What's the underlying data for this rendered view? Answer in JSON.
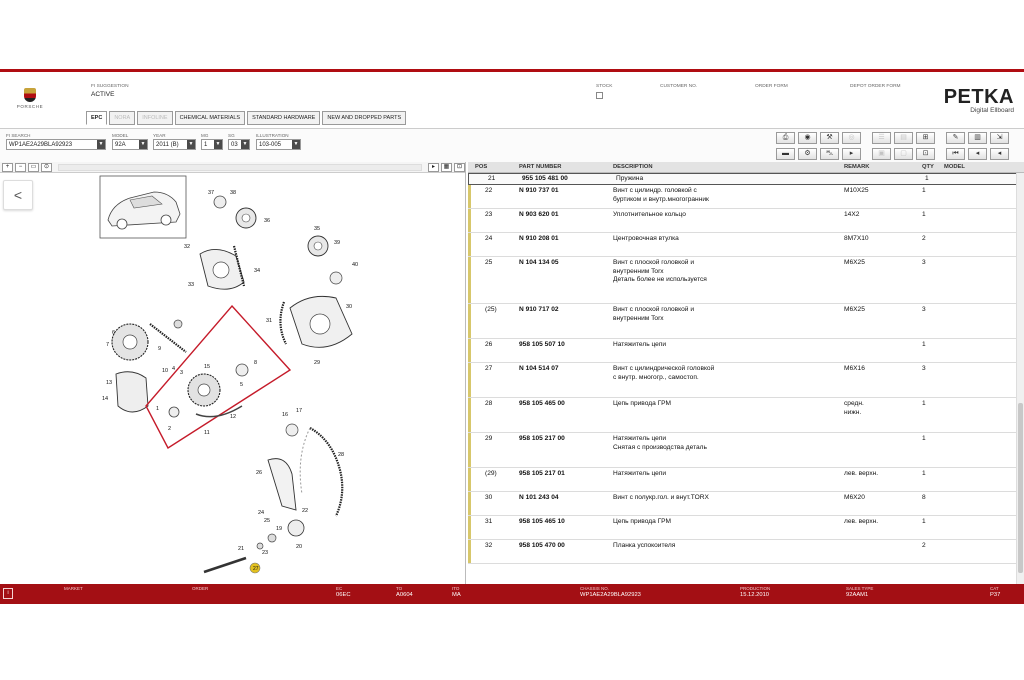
{
  "header": {
    "logo_text": "PORSCHE",
    "fi_suggestion_label": "FI SUGGESTION",
    "fi_suggestion_value": "ACTIVE",
    "stock_label": "STOCK",
    "customer_no_label": "CUSTOMER NO.",
    "order_form_label": "ORDER FORM",
    "depot_order_form_label": "DEPOT ORDER FORM",
    "petka_title": "PETKA",
    "petka_subtitle": "Digital Ellboard"
  },
  "tabs": [
    {
      "label": "EPC"
    },
    {
      "label": "NORA"
    },
    {
      "label": "INFOLINE"
    },
    {
      "label": "CHEMICAL MATERIALS"
    },
    {
      "label": "STANDARD HARDWARE"
    },
    {
      "label": "NEW AND DROPPED PARTS"
    }
  ],
  "filters": {
    "fi_search_label": "FI SEARCH",
    "fi_search_value": "WP1AE2A29BLA92923",
    "model_label": "MODEL",
    "model_value": "92A",
    "year_label": "YEAR",
    "year_value": "2011 (B)",
    "mg_label": "MG",
    "mg_value": "1",
    "sg_label": "SG",
    "sg_value": "03",
    "illustration_label": "ILLUSTRATION",
    "illustration_value": "103-005"
  },
  "table": {
    "headers": {
      "pos": "POS",
      "part_number": "PART NUMBER",
      "description": "DESCRIPTION",
      "remark": "REMARK",
      "qty": "QTY",
      "model": "MODEL"
    },
    "rows": [
      {
        "pos": "21",
        "part": "955 105 481 00",
        "desc": "Пружина",
        "remark": "",
        "qty": "1"
      },
      {
        "pos": "22",
        "part": "N  910 737 01",
        "desc": "Винт с цилиндр. головкой с\nбуртиком и внутр.многогранник",
        "remark": "M10X25",
        "qty": "1"
      },
      {
        "pos": "23",
        "part": "N  903 620 01",
        "desc": "Уплотнительное кольцо",
        "remark": "14X2",
        "qty": "1"
      },
      {
        "pos": "24",
        "part": "N  910 208 01",
        "desc": "Центровочная втулка",
        "remark": "8M7X10",
        "qty": "2"
      },
      {
        "pos": "25",
        "part": "N  104 134 05",
        "desc": "Винт с плоской головкой и\nвнутренним Torx\nДеталь более не используется",
        "remark": "M6X25",
        "qty": "3"
      },
      {
        "pos": "(25)",
        "part": "N  910 717 02",
        "desc": "Винт с плоской головкой и\nвнутренним Torx",
        "remark": "M6X25",
        "qty": "3"
      },
      {
        "pos": "26",
        "part": "958 105 507 10",
        "desc": "Натяжитель цепи",
        "remark": "",
        "qty": "1"
      },
      {
        "pos": "27",
        "part": "N  104 514 07",
        "desc": "Винт с цилиндрической головкой\nс внутр. многогр., самостоп.",
        "remark": "M6X16",
        "qty": "3"
      },
      {
        "pos": "28",
        "part": "958 105 465 00",
        "desc": "Цепь привода ГРМ",
        "remark": "средн.\nнижн.",
        "qty": "1"
      },
      {
        "pos": "29",
        "part": "958 105 217 00",
        "desc": "Натяжитель цепи\nСнятая с производства деталь",
        "remark": "",
        "qty": "1"
      },
      {
        "pos": "(29)",
        "part": "958 105 217 01",
        "desc": "Натяжитель цепи",
        "remark": "лев. верхн.",
        "qty": "1"
      },
      {
        "pos": "30",
        "part": "N  101 243 04",
        "desc": "Винт с полукр.гол. и внут.TORX",
        "remark": "M6X20",
        "qty": "8"
      },
      {
        "pos": "31",
        "part": "958 105 465 10",
        "desc": "Цепь привода ГРМ",
        "remark": "лев. верхн.",
        "qty": "1"
      },
      {
        "pos": "32",
        "part": "958 105 470 00",
        "desc": "Планка успокоителя",
        "remark": "",
        "qty": "2"
      }
    ]
  },
  "diagram": {
    "callouts": [
      "37",
      "38",
      "36",
      "32",
      "34",
      "33",
      "35",
      "39",
      "40",
      "31",
      "30",
      "29",
      "7",
      "6",
      "10",
      "9",
      "3",
      "13",
      "14",
      "12",
      "11",
      "2",
      "1",
      "4",
      "5",
      "8",
      "15",
      "16",
      "17",
      "26",
      "28",
      "24",
      "25",
      "22",
      "23",
      "20",
      "21",
      "19",
      "27"
    ]
  },
  "footer": {
    "market_label": "MARKET",
    "order_label": "ORDER",
    "ec_label": "EC",
    "ec_value": "06EC",
    "to_label": "TO",
    "to_value": "A0604",
    "ito_label": "ITO",
    "ito_value": "MA",
    "chassis_label": "CHASSIS NO.",
    "chassis_value": "WP1AE2A29BLA92923",
    "production_label": "PRODUCTION",
    "production_value": "15.12.2010",
    "sales_type_label": "SALES TYPE",
    "sales_type_value": "92AAM1",
    "cat_label": "CAT",
    "cat_value": "P37"
  },
  "colors": {
    "accent": "#b00d12",
    "footer": "#a30f14",
    "highlight": "#d7c76b"
  }
}
